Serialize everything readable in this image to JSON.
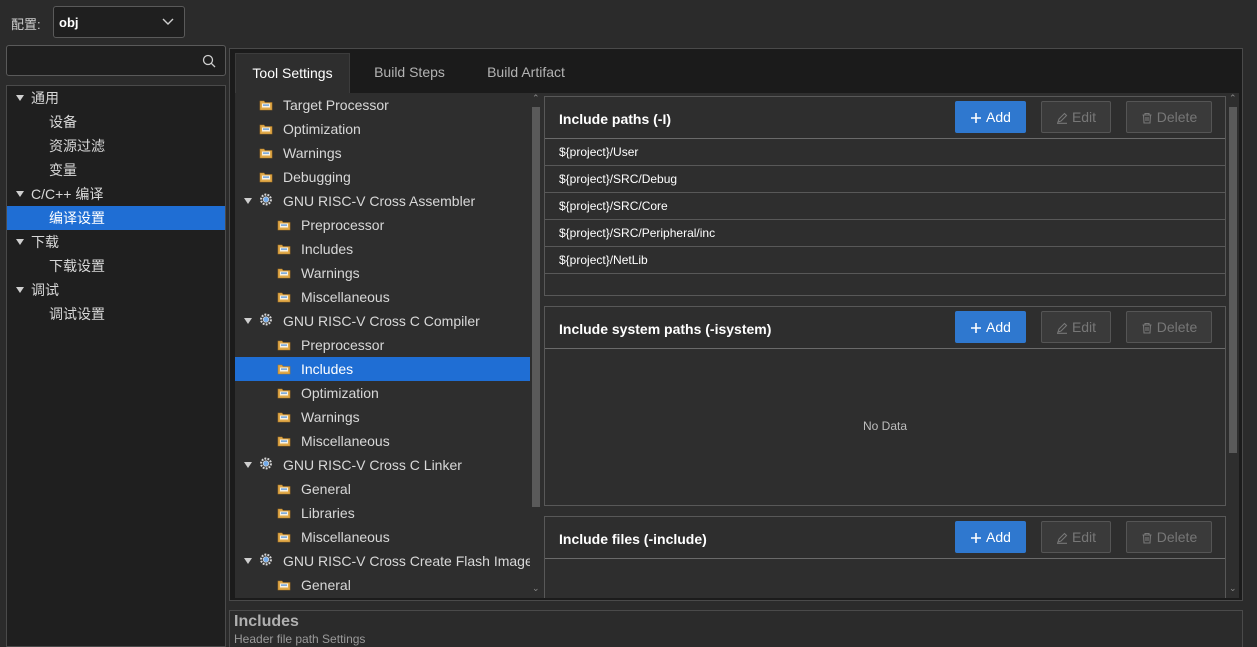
{
  "config": {
    "label": "配置:",
    "value": "obj"
  },
  "nav": {
    "items": [
      {
        "label": "通用",
        "type": "group"
      },
      {
        "label": "设备",
        "type": "child"
      },
      {
        "label": "资源过滤",
        "type": "child"
      },
      {
        "label": "变量",
        "type": "child"
      },
      {
        "label": "C/C++ 编译",
        "type": "group"
      },
      {
        "label": "编译设置",
        "type": "child",
        "selected": true
      },
      {
        "label": "下载",
        "type": "group"
      },
      {
        "label": "下载设置",
        "type": "child"
      },
      {
        "label": "调试",
        "type": "group"
      },
      {
        "label": "调试设置",
        "type": "child"
      }
    ]
  },
  "tabs": [
    "Tool Settings",
    "Build Steps",
    "Build Artifact"
  ],
  "tree": {
    "items": [
      {
        "label": "Target Processor",
        "level": 1,
        "icon": "folder-settings-icon"
      },
      {
        "label": "Optimization",
        "level": 1,
        "icon": "folder-settings-icon"
      },
      {
        "label": "Warnings",
        "level": 1,
        "icon": "folder-settings-icon"
      },
      {
        "label": "Debugging",
        "level": 1,
        "icon": "folder-settings-icon"
      },
      {
        "label": "GNU RISC-V Cross Assembler",
        "level": 0,
        "icon": "gear-icon"
      },
      {
        "label": "Preprocessor",
        "level": 2,
        "icon": "folder-settings-icon"
      },
      {
        "label": "Includes",
        "level": 2,
        "icon": "folder-settings-icon"
      },
      {
        "label": "Warnings",
        "level": 2,
        "icon": "folder-settings-icon"
      },
      {
        "label": "Miscellaneous",
        "level": 2,
        "icon": "folder-settings-icon"
      },
      {
        "label": "GNU RISC-V Cross C Compiler",
        "level": 0,
        "icon": "gear-icon"
      },
      {
        "label": "Preprocessor",
        "level": 2,
        "icon": "folder-settings-icon"
      },
      {
        "label": "Includes",
        "level": 2,
        "icon": "folder-settings-icon",
        "selected": true
      },
      {
        "label": "Optimization",
        "level": 2,
        "icon": "folder-settings-icon"
      },
      {
        "label": "Warnings",
        "level": 2,
        "icon": "folder-settings-icon"
      },
      {
        "label": "Miscellaneous",
        "level": 2,
        "icon": "folder-settings-icon"
      },
      {
        "label": "GNU RISC-V Cross C Linker",
        "level": 0,
        "icon": "gear-icon"
      },
      {
        "label": "General",
        "level": 2,
        "icon": "folder-settings-icon"
      },
      {
        "label": "Libraries",
        "level": 2,
        "icon": "folder-settings-icon"
      },
      {
        "label": "Miscellaneous",
        "level": 2,
        "icon": "folder-settings-icon"
      },
      {
        "label": "GNU RISC-V Cross Create Flash Image",
        "level": 0,
        "icon": "gear-icon"
      },
      {
        "label": "General",
        "level": 2,
        "icon": "folder-settings-icon"
      }
    ]
  },
  "buttons": {
    "add": "Add",
    "edit": "Edit",
    "delete": "Delete"
  },
  "sections": {
    "include_paths": {
      "title": "Include paths (-I)",
      "rows": [
        "${project}/User",
        "${project}/SRC/Debug",
        "${project}/SRC/Core",
        "${project}/SRC/Peripheral/inc",
        "${project}/NetLib"
      ]
    },
    "include_system_paths": {
      "title": "Include system paths (-isystem)",
      "empty_text": "No Data"
    },
    "include_files": {
      "title": "Include files (-include)"
    }
  },
  "description": {
    "title": "Includes",
    "subtitle": "Header file path Settings"
  },
  "colors": {
    "accent": "#1f6ed4",
    "add_button": "#2f78cf",
    "background": "#2b2b2b",
    "panel": "#2e2e2e"
  }
}
